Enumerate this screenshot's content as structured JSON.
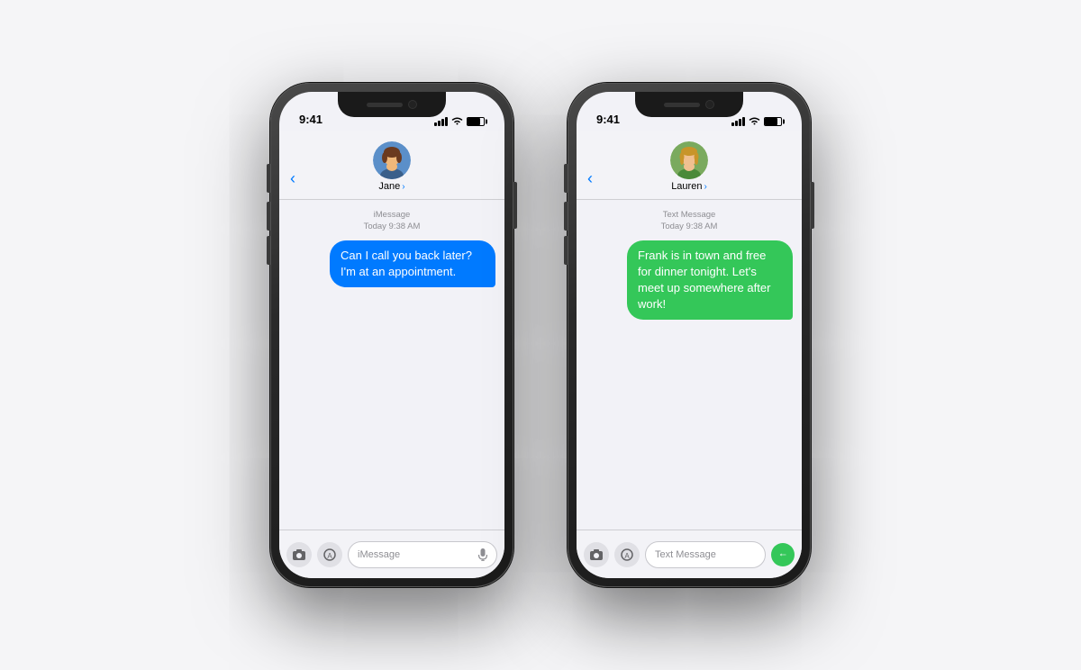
{
  "background_color": "#f5f5f7",
  "phones": [
    {
      "id": "phone-left",
      "status_bar": {
        "time": "9:41",
        "signal_bars": [
          2,
          3,
          4,
          5
        ],
        "wifi": true,
        "battery": 80
      },
      "contact": {
        "name": "Jane",
        "name_with_chevron": "Jane ›",
        "avatar_type": "jane"
      },
      "message_type_label": "iMessage",
      "message_date": "Today 9:38 AM",
      "messages": [
        {
          "text": "Can I call you back later? I'm at an appointment.",
          "type": "sent",
          "bubble_color": "blue"
        }
      ],
      "input": {
        "placeholder": "iMessage",
        "has_send_btn": false,
        "has_mic": true,
        "send_btn_color": "#007aff"
      }
    },
    {
      "id": "phone-right",
      "status_bar": {
        "time": "9:41",
        "signal_bars": [
          2,
          3,
          4,
          5
        ],
        "wifi": true,
        "battery": 80
      },
      "contact": {
        "name": "Lauren",
        "name_with_chevron": "Lauren ›",
        "avatar_type": "lauren"
      },
      "message_type_label": "Text Message",
      "message_date": "Today 9:38 AM",
      "messages": [
        {
          "text": "Frank is in town and free for dinner tonight. Let's meet up somewhere after work!",
          "type": "sent",
          "bubble_color": "green"
        }
      ],
      "input": {
        "placeholder": "Text Message",
        "has_send_btn": true,
        "has_mic": false,
        "send_btn_color": "#34c759"
      }
    }
  ],
  "icons": {
    "back_arrow": "‹",
    "chevron_right": "›",
    "camera": "📷",
    "appstore": "",
    "mic": "🎤",
    "send": "↑"
  }
}
